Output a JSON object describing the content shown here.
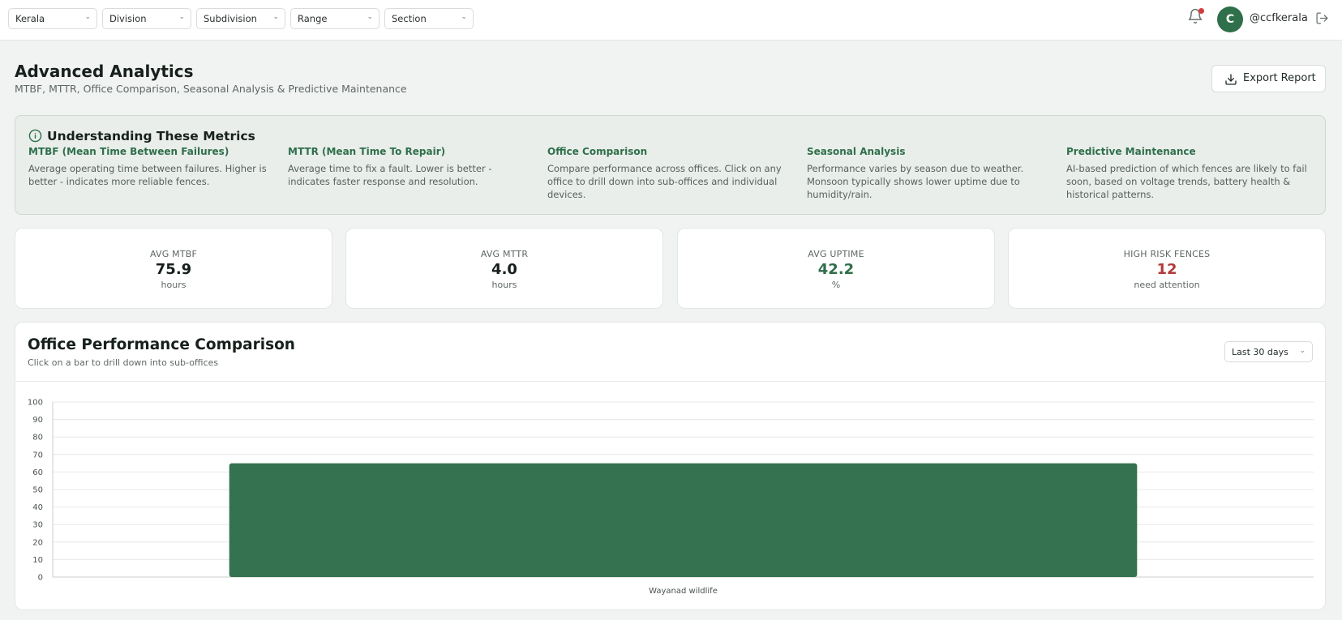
{
  "filters": [
    {
      "value": "Kerala"
    },
    {
      "value": "Division"
    },
    {
      "value": "Subdivision"
    },
    {
      "value": "Range"
    },
    {
      "value": "Section"
    }
  ],
  "user": {
    "initial": "C",
    "handle": "@ccfkerala"
  },
  "header": {
    "title": "Advanced Analytics",
    "subtitle": "MTBF, MTTR, Office Comparison, Seasonal Analysis & Predictive Maintenance",
    "export_label": "Export Report"
  },
  "info": {
    "heading": "Understanding These Metrics",
    "items": [
      {
        "title": "MTBF (Mean Time Between Failures)",
        "desc": "Average operating time between failures. Higher is better - indicates more reliable fences."
      },
      {
        "title": "MTTR (Mean Time To Repair)",
        "desc": "Average time to fix a fault. Lower is better - indicates faster response and resolution."
      },
      {
        "title": "Office Comparison",
        "desc": "Compare performance across offices. Click on any office to drill down into sub-offices and individual devices."
      },
      {
        "title": "Seasonal Analysis",
        "desc": "Performance varies by season due to weather. Monsoon typically shows lower uptime due to humidity/rain."
      },
      {
        "title": "Predictive Maintenance",
        "desc": "AI-based prediction of which fences are likely to fail soon, based on voltage trends, battery health & historical patterns."
      }
    ]
  },
  "stats": [
    {
      "label": "AVG MTBF",
      "value": "75.9",
      "unit": "hours",
      "color": "#17201b"
    },
    {
      "label": "AVG MTTR",
      "value": "4.0",
      "unit": "hours",
      "color": "#17201b"
    },
    {
      "label": "AVG UPTIME",
      "value": "42.2",
      "unit": "%",
      "color": "#2f6f4a"
    },
    {
      "label": "HIGH RISK FENCES",
      "value": "12",
      "unit": "need attention",
      "color": "#b23a3a"
    }
  ],
  "chart": {
    "title": "Office Performance Comparison",
    "subtitle": "Click on a bar to drill down into sub-offices",
    "range_label": "Last 30 days"
  },
  "chart_data": {
    "type": "bar",
    "categories": [
      "Wayanad wildlife"
    ],
    "values": [
      65
    ],
    "ylim": [
      0,
      100
    ],
    "yticks": [
      0,
      10,
      20,
      30,
      40,
      50,
      60,
      70,
      80,
      90,
      100
    ],
    "grid": true,
    "bar_color": "#357350"
  },
  "colors": {
    "accent": "#2f6f4a",
    "danger": "#b23a3a",
    "notification": "#d43b3b"
  }
}
